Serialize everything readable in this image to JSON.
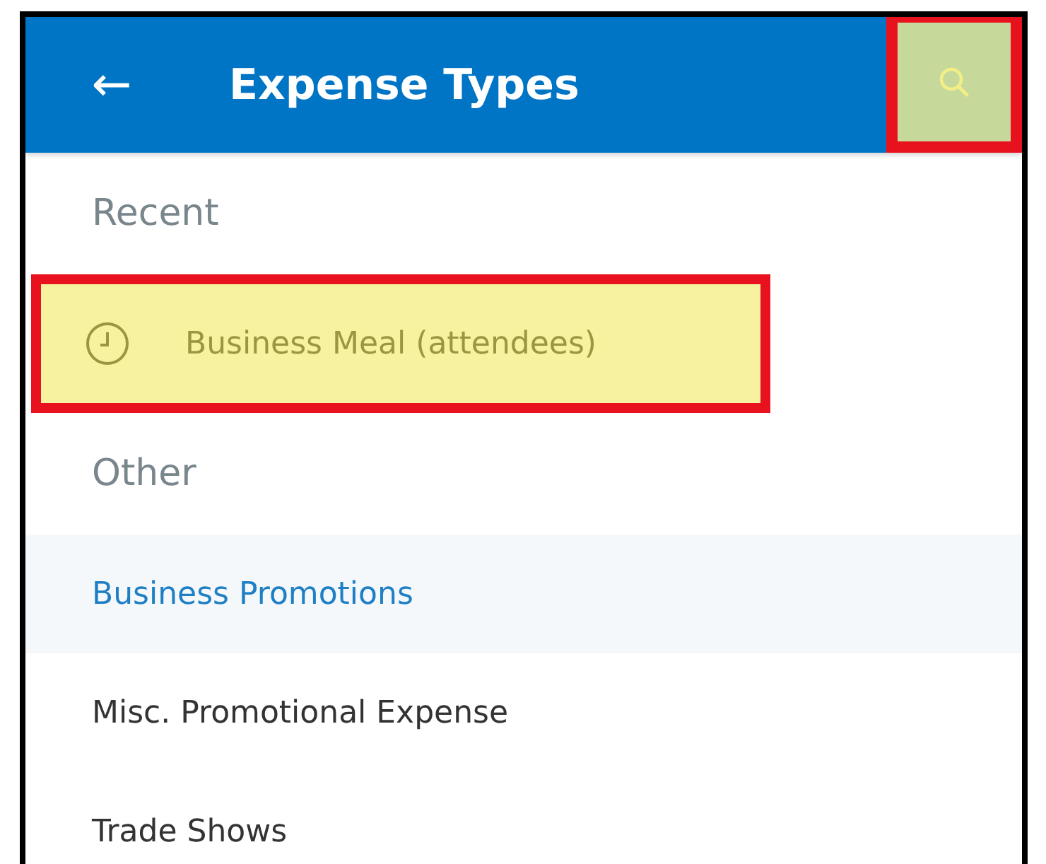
{
  "header": {
    "back": "←",
    "title": "Expense Types",
    "search": {
      "highlighted": true
    }
  },
  "groups": [
    {
      "heading": "Recent",
      "items": [
        {
          "kind": "recent",
          "label": "Business Meal (attendees)",
          "selected": false,
          "highlighted": true
        }
      ]
    },
    {
      "heading": "Other",
      "items": [
        {
          "kind": "plain",
          "label": "Business Promotions",
          "selected": true,
          "highlighted": false
        },
        {
          "kind": "plain",
          "label": "Misc. Promotional Expense",
          "selected": false,
          "highlighted": false
        },
        {
          "kind": "plain",
          "label": "Trade Shows",
          "selected": false,
          "highlighted": false
        }
      ]
    }
  ]
}
